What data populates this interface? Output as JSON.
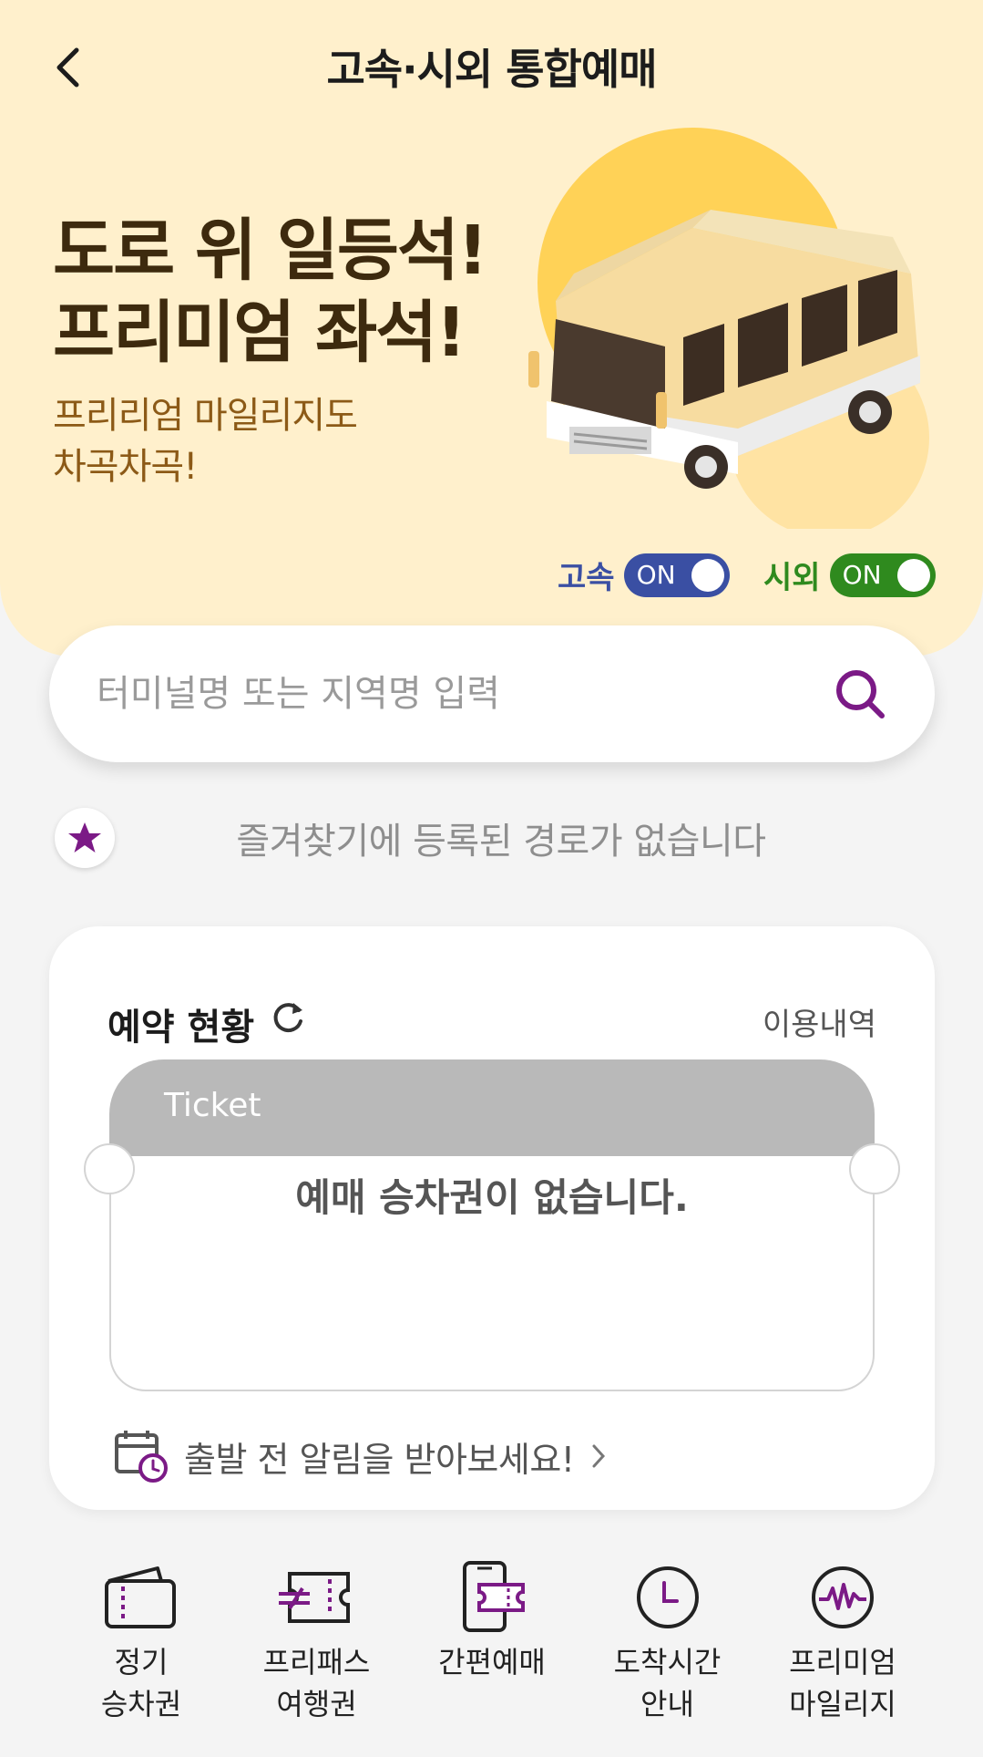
{
  "header": {
    "title": "고속·시외 통합예매"
  },
  "hero": {
    "headline_1": "도로 위 일등석!",
    "headline_2": "프리미엄 좌석!",
    "sub_1": "프리리엄 마일리지도",
    "sub_2": "차곡차곡!"
  },
  "toggles": {
    "express_label": "고속",
    "express_state": "ON",
    "intercity_label": "시외",
    "intercity_state": "ON"
  },
  "search": {
    "placeholder": "터미널명 또는 지역명 입력",
    "value": ""
  },
  "favorites": {
    "empty_text": "즐겨찾기에 등록된 경로가 없습니다"
  },
  "reservation": {
    "title": "예약 현황",
    "history_link": "이용내역",
    "ticket_label": "Ticket",
    "empty_text": "예매 승차권이 없습니다.",
    "alarm_text": "출발 전 알림을 받아보세요!"
  },
  "quick_menu": [
    {
      "label": "정기\n승차권",
      "icon": "wallet-icon"
    },
    {
      "label": "프리패스\n여행권",
      "icon": "ticket-pass-icon"
    },
    {
      "label": "간편예매",
      "icon": "phone-ticket-icon"
    },
    {
      "label": "도착시간\n안내",
      "icon": "clock-icon"
    },
    {
      "label": "프리미엄\n마일리지",
      "icon": "mileage-icon"
    }
  ],
  "colors": {
    "hero_bg": "#fff0cc",
    "brand_purple": "#7b1a86",
    "express_blue": "#3a4fa3",
    "intercity_green": "#2f8a1e"
  }
}
